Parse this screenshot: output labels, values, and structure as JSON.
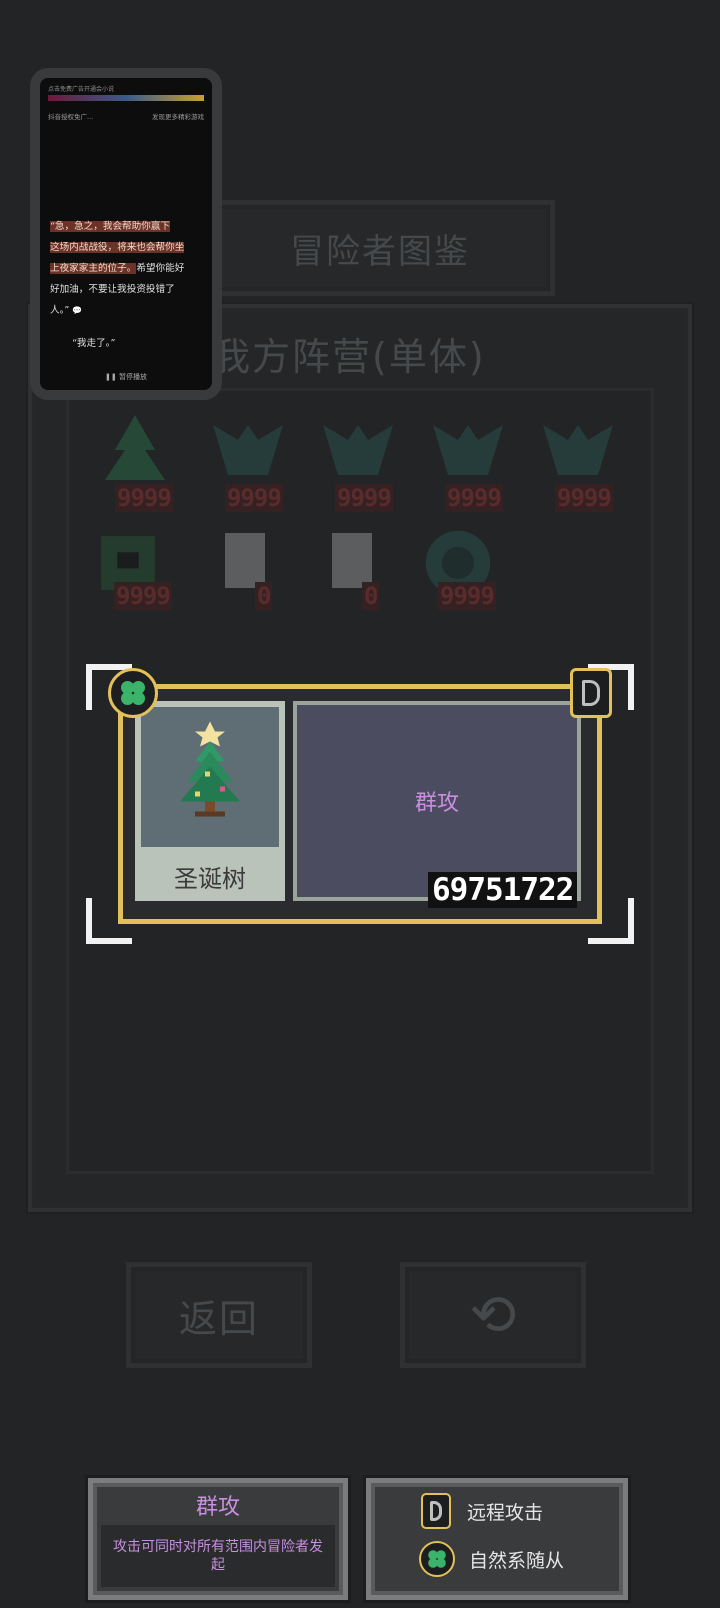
{
  "background": {
    "top_button": "冒险者图鉴",
    "panel_title": "我方阵营(单体)",
    "units_row1_hp": [
      "9999",
      "9999",
      "9999",
      "9999",
      "9999"
    ],
    "units_row2_hp": [
      "9999",
      "0",
      "0",
      "9999"
    ],
    "back_button": "返回"
  },
  "mini_player": {
    "top_link": "点击免费广告开通会小说",
    "link_left": "抖音授权免广...",
    "link_right": "发现更多精彩游戏",
    "line1": "“急，急之，我会帮助你赢下",
    "line2": "这场内战战役，将来也会帮你坐",
    "line3_hl": "上夜家家主的位子。",
    "line3_rest": "希望你能好",
    "line4": "好加油，不要让我投资投错了",
    "line5": "人。”",
    "line6": "“我走了。”",
    "pause_label": "暂停播放"
  },
  "card": {
    "name": "圣诞树",
    "skill": "群攻",
    "number": "69751722",
    "colors": {
      "accent": "#e2c05a",
      "skill_text": "#c88fe0",
      "panel": "#4b4c5f",
      "portrait_bg": "#5f6e74"
    }
  },
  "tips": {
    "skill_title": "群攻",
    "skill_desc": "攻击可同时对所有范围内冒险者发起",
    "traits": [
      {
        "icon": "ranged-icon",
        "label": "远程攻击"
      },
      {
        "icon": "clover-icon",
        "label": "自然系随从"
      }
    ]
  }
}
